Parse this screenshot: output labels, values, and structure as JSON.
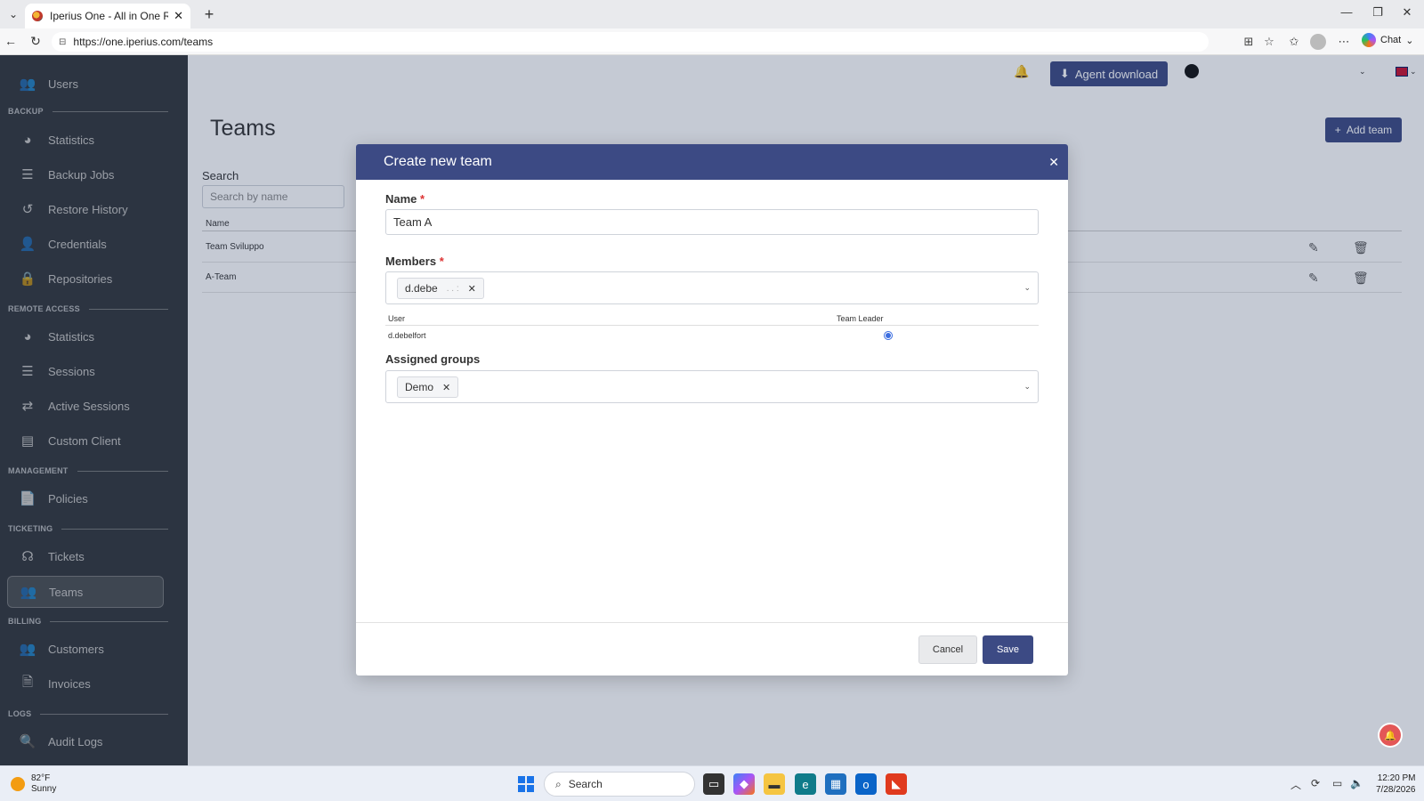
{
  "browser": {
    "tab_title": "Iperius One - All in One RMM Suit",
    "tab_close": "✕",
    "new_tab": "+",
    "url": "https://one.iperius.com/teams",
    "chat_label": "Chat"
  },
  "sidebar": {
    "top_item": "Users",
    "sections": {
      "backup": "BACKUP",
      "remote": "REMOTE ACCESS",
      "management": "MANAGEMENT",
      "ticketing": "TICKETING",
      "billing": "BILLING",
      "logs": "LOGS"
    },
    "backup_items": [
      "Statistics",
      "Backup Jobs",
      "Restore History",
      "Credentials",
      "Repositories"
    ],
    "remote_items": [
      "Statistics",
      "Sessions",
      "Active Sessions",
      "Custom Client"
    ],
    "management_items": [
      "Policies"
    ],
    "ticketing_items": [
      "Tickets",
      "Teams"
    ],
    "billing_items": [
      "Customers",
      "Invoices"
    ],
    "logs_items": [
      "Audit Logs"
    ],
    "active_item": "Teams"
  },
  "header": {
    "agent_download": "Agent download"
  },
  "page": {
    "title": "Teams",
    "add_team": "Add team",
    "search_label": "Search",
    "search_placeholder": "Search by name",
    "table_header": "Name",
    "rows": [
      "Team Sviluppo",
      "A-Team"
    ]
  },
  "modal": {
    "title": "Create new team",
    "close": "✕",
    "name_label": "Name",
    "required_mark": "*",
    "name_value": "Team A",
    "members_label": "Members",
    "member_chip": "d.debe",
    "chip_remove": "✕",
    "members_table": {
      "col_user": "User",
      "col_leader": "Team Leader",
      "rows": [
        {
          "user": "d.debelfort",
          "leader": true
        }
      ]
    },
    "groups_label": "Assigned groups",
    "group_chip": "Demo",
    "cancel": "Cancel",
    "save": "Save"
  },
  "taskbar": {
    "temperature": "82°F",
    "weather": "Sunny",
    "search": "Search",
    "time": "12:20 PM",
    "date": "7/28/2026"
  },
  "colors": {
    "primary": "#3c4a84",
    "sidebar_bg": "#2c3441",
    "required": "#d33333",
    "radio": "#3b6de0"
  }
}
